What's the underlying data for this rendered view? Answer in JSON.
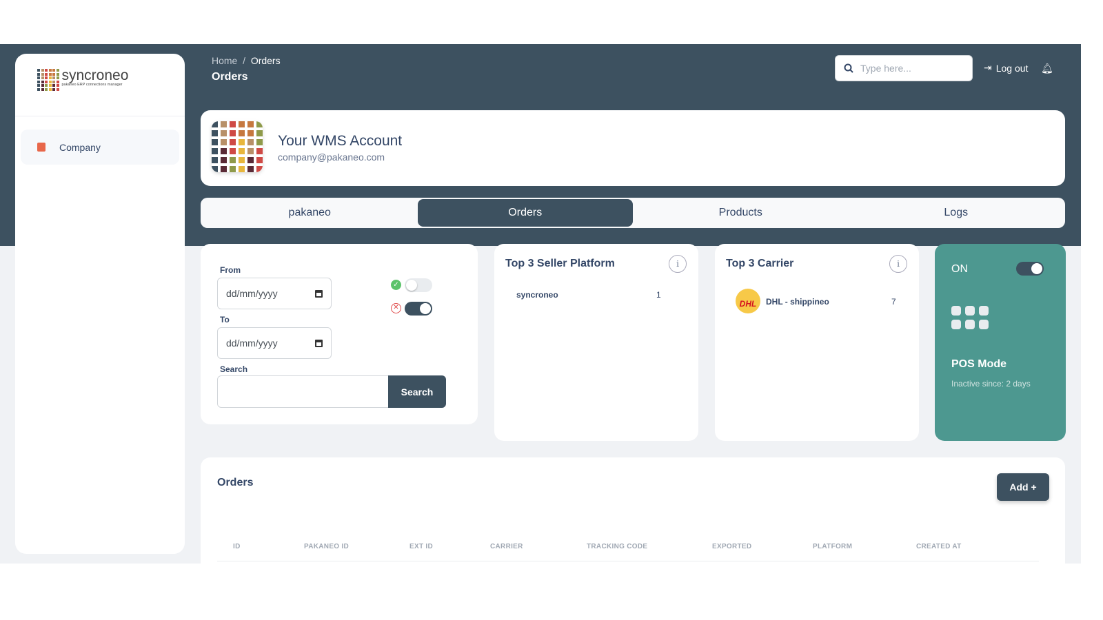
{
  "sidebar": {
    "logo_name": "syncroneo",
    "logo_tagline": "pakaneo ERP connections manager",
    "items": [
      {
        "label": "Company",
        "icon": "archive-box-icon"
      }
    ]
  },
  "header": {
    "breadcrumb": [
      "Home",
      "Orders"
    ],
    "title": "Orders",
    "search_placeholder": "Type here...",
    "logout_label": "Log out"
  },
  "account": {
    "name": "Your WMS Account",
    "email": "company@pakaneo.com"
  },
  "tabs": [
    {
      "label": "pakaneo"
    },
    {
      "label": "Orders",
      "active": true
    },
    {
      "label": "Products"
    },
    {
      "label": "Logs"
    }
  ],
  "filters": {
    "from_label": "From",
    "from_placeholder": "dd/mm/yyyy",
    "to_label": "To",
    "to_placeholder": "dd/mm/yyyy",
    "search_label": "Search",
    "search_value": "",
    "search_button": "Search",
    "toggle_success": false,
    "toggle_error": true
  },
  "seller": {
    "title": "Top 3 Seller Platform",
    "items": [
      {
        "name": "syncroneo",
        "count": "1"
      }
    ]
  },
  "carrier": {
    "title": "Top 3 Carrier",
    "items": [
      {
        "name": "DHL - shippineo",
        "count": "7"
      }
    ]
  },
  "pos": {
    "state": "ON",
    "enabled": true,
    "title": "POS Mode",
    "subtitle": "Inactive since: 2 days"
  },
  "orders": {
    "title": "Orders",
    "add_button": "Add +",
    "columns": [
      "ID",
      "PAKANEO ID",
      "EXT ID",
      "CARRIER",
      "TRACKING CODE",
      "EXPORTED",
      "PLATFORM",
      "CREATED AT"
    ]
  },
  "colors": {
    "primary": "#3d5160",
    "teal": "#4d9890",
    "accent": "#e8674a"
  }
}
